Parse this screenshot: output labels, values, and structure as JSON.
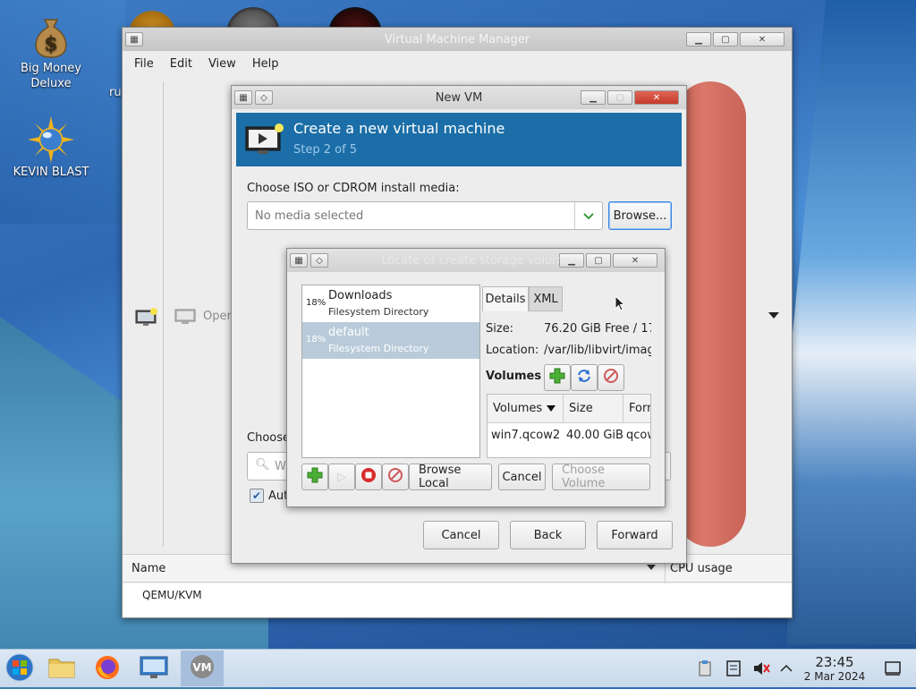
{
  "desktop": {
    "icons": [
      {
        "label": "Big Money Deluxe"
      },
      {
        "label": "KEVIN BLAST"
      }
    ],
    "partial_label": "ru"
  },
  "vmm": {
    "title": "Virtual Machine Manager",
    "menu": [
      "File",
      "Edit",
      "View",
      "Help"
    ],
    "list_header_name": "Name",
    "list_header_cpu": "CPU usage",
    "connection": "QEMU/KVM",
    "open_partial": "Oper"
  },
  "newvm": {
    "title": "New VM",
    "banner_title": "Create a new virtual machine",
    "banner_step": "Step 2 of 5",
    "media_label": "Choose ISO or CDROM install media:",
    "media_placeholder": "No media selected",
    "browse_label": "Browse...",
    "choose_partial": "Choose",
    "search_partial": "Wi",
    "auto_partial": "Auto",
    "cancel_label": "Cancel",
    "back_label": "Back",
    "forward_label": "Forward"
  },
  "volsel": {
    "title": "Locate or create storage volume",
    "pools": [
      {
        "pct": "18%",
        "name": "Downloads",
        "type": "Filesystem Directory",
        "selected": false
      },
      {
        "pct": "18%",
        "name": "default",
        "type": "Filesystem Directory",
        "selected": true
      }
    ],
    "tabs": [
      "Details",
      "XML"
    ],
    "size_label": "Size:",
    "size_value": "76.20 GiB Free / 17.",
    "location_label": "Location:",
    "location_value": "/var/lib/libvirt/imag",
    "volumes_label": "Volumes",
    "columns": [
      "Volumes",
      "Size",
      "Forr"
    ],
    "rows": [
      {
        "name": "win7.qcow2",
        "size": "40.00 GiB",
        "format": "qcow"
      }
    ],
    "browse_local_label": "Browse Local",
    "cancel_label": "Cancel",
    "choose_volume_label": "Choose Volume"
  },
  "taskbar": {
    "time": "23:45",
    "date": "2 Mar 2024"
  }
}
